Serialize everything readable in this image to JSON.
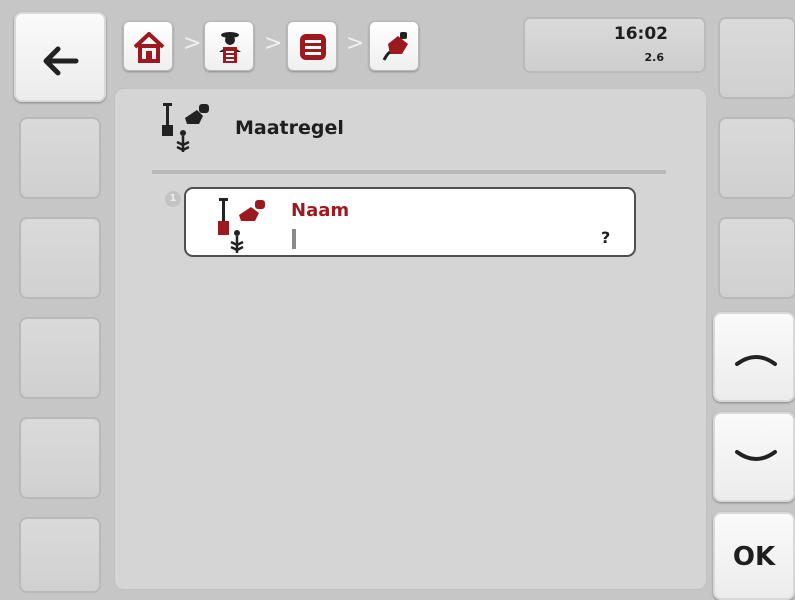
{
  "header": {
    "time": "16:02",
    "version": "2.6",
    "separator": ">"
  },
  "breadcrumb": [
    {
      "icon": "home-icon"
    },
    {
      "icon": "user-info-icon"
    },
    {
      "icon": "list-icon"
    },
    {
      "icon": "spray-measure-icon"
    }
  ],
  "page": {
    "title": "Maatregel",
    "title_icon": "spray-measure-icon"
  },
  "form": {
    "fields": [
      {
        "index": "1",
        "label": "Naam",
        "value": "",
        "status": "?"
      }
    ]
  },
  "softkeys": {
    "ok_label": "OK"
  },
  "colors": {
    "accent": "#9c1a1f",
    "background": "#c6c6c6",
    "panel": "#d5d5d5"
  }
}
